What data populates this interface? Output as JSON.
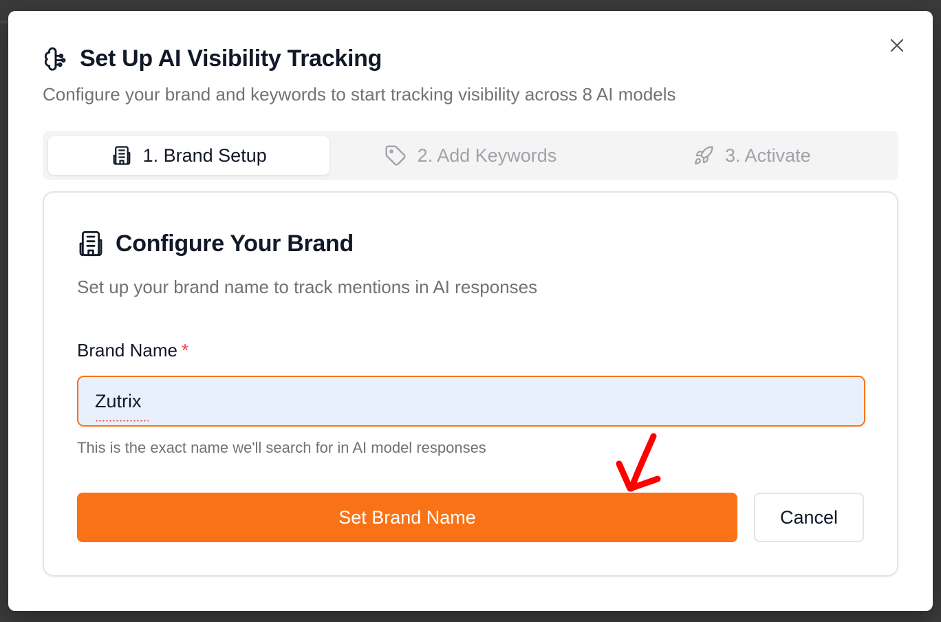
{
  "dialog": {
    "title": "Set Up AI Visibility Tracking",
    "subtitle": "Configure your brand and keywords to start tracking visibility across 8 AI models",
    "close_icon": "close-icon",
    "header_icon": "brain-icon"
  },
  "tabs": [
    {
      "label": "1. Brand Setup",
      "icon": "building-icon",
      "active": true
    },
    {
      "label": "2. Add Keywords",
      "icon": "tag-icon",
      "active": false
    },
    {
      "label": "3. Activate",
      "icon": "rocket-icon",
      "active": false
    }
  ],
  "card": {
    "title": "Configure Your Brand",
    "description": "Set up your brand name to track mentions in AI responses",
    "field_label": "Brand Name",
    "required_mark": "*",
    "input_value": "Zutrix",
    "helper_text": "This is the exact name we'll search for in AI model responses",
    "primary_button": "Set Brand Name",
    "cancel_button": "Cancel"
  },
  "colors": {
    "accent": "#f97316",
    "required": "#ef4444",
    "input_bg": "#e8f0fe",
    "annotation": "#ff0000"
  }
}
